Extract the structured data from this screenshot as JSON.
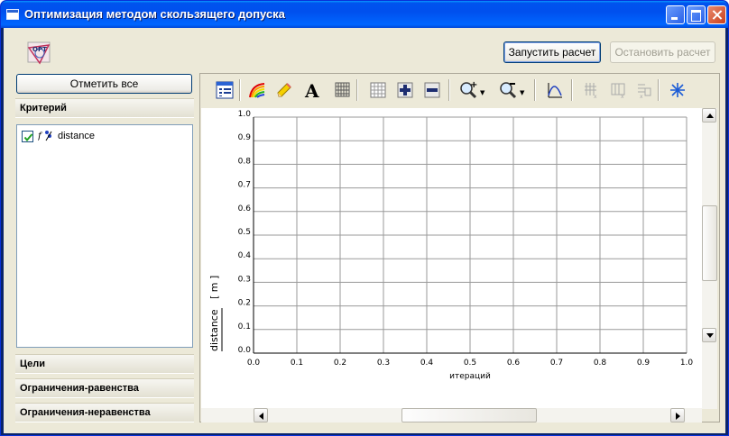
{
  "window": {
    "title": "Оптимизация методом скользящего допуска"
  },
  "header": {
    "run_label": "Запустить расчет",
    "stop_label": "Остановить расчет"
  },
  "left_panel": {
    "mark_all_label": "Отметить все",
    "criteria_header": "Критерий",
    "criteria": [
      {
        "label": "distance",
        "checked": true
      }
    ],
    "goals_header": "Цели",
    "eq_constraints_header": "Ограничения-равенства",
    "ineq_constraints_header": "Ограничения-неравенства"
  },
  "chart_data": {
    "type": "line",
    "title": "",
    "xlabel": "итераций",
    "ylabel": "distance",
    "yunit": "[ m ]",
    "xlim": [
      0.0,
      1.0
    ],
    "ylim": [
      0.0,
      1.0
    ],
    "xticks": [
      "0.0",
      "0.1",
      "0.2",
      "0.3",
      "0.4",
      "0.5",
      "0.6",
      "0.7",
      "0.8",
      "0.9",
      "1.0"
    ],
    "yticks": [
      "0.0",
      "0.1",
      "0.2",
      "0.3",
      "0.4",
      "0.5",
      "0.6",
      "0.7",
      "0.8",
      "0.9",
      "1.0"
    ],
    "grid": true,
    "series": []
  }
}
